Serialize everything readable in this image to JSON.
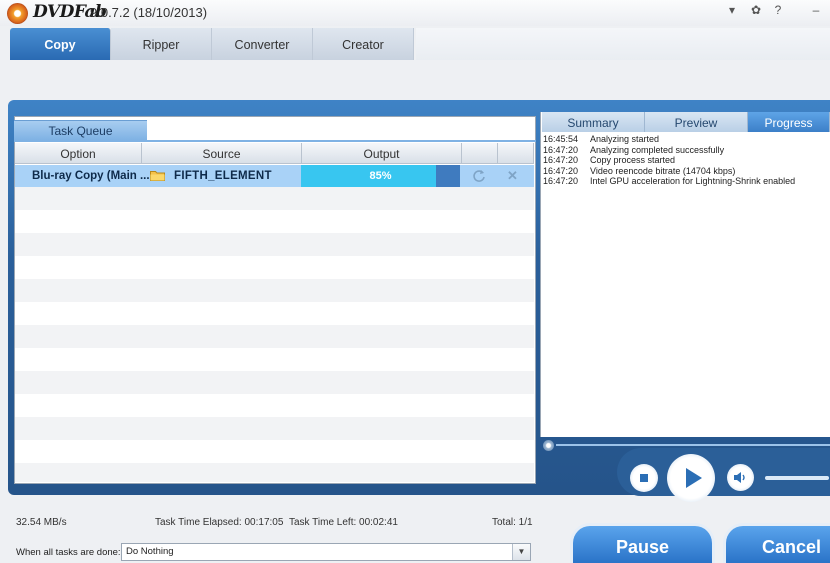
{
  "app": {
    "brand": "DVDFab",
    "version": "9.0.7.2 (18/10/2013)",
    "window_controls": [
      "▾",
      "✿",
      "?",
      "–"
    ]
  },
  "tabs": [
    {
      "label": "Copy",
      "active": true
    },
    {
      "label": "Ripper",
      "active": false
    },
    {
      "label": "Converter",
      "active": false
    },
    {
      "label": "Creator",
      "active": false
    }
  ],
  "queue": {
    "tab_label": "Task Queue",
    "columns": [
      "Option",
      "Source",
      "Output"
    ],
    "task": {
      "option": "Blu-ray Copy (Main ...",
      "source": "FIFTH_ELEMENT",
      "progress_text": "85%",
      "progress_fraction": 0.85
    }
  },
  "right_tabs": [
    {
      "label": "Summary",
      "active": false
    },
    {
      "label": "Preview",
      "active": false
    },
    {
      "label": "Progress",
      "active": true
    }
  ],
  "log": [
    {
      "time": "16:45:54",
      "message": "Analyzing started"
    },
    {
      "time": "16:47:20",
      "message": "Analyzing completed successfully"
    },
    {
      "time": "16:47:20",
      "message": "Copy process started"
    },
    {
      "time": "16:47:20",
      "message": "Video reencode bitrate (14704 kbps)"
    },
    {
      "time": "16:47:20",
      "message": "Intel GPU acceleration for Lightning-Shrink enabled"
    }
  ],
  "status": {
    "speed": "32.54 MB/s",
    "elapsed": "Task Time Elapsed: 00:17:05",
    "left": "Task Time Left: 00:02:41",
    "total": "Total: 1/1"
  },
  "when_done": {
    "label": "When all tasks are done:",
    "value": "Do Nothing"
  },
  "buttons": {
    "pause": "Pause",
    "cancel": "Cancel"
  },
  "colors": {
    "accent": "#2a73c8",
    "progress_fill": "#38c6f0",
    "selected_row": "#a9d2f7"
  }
}
